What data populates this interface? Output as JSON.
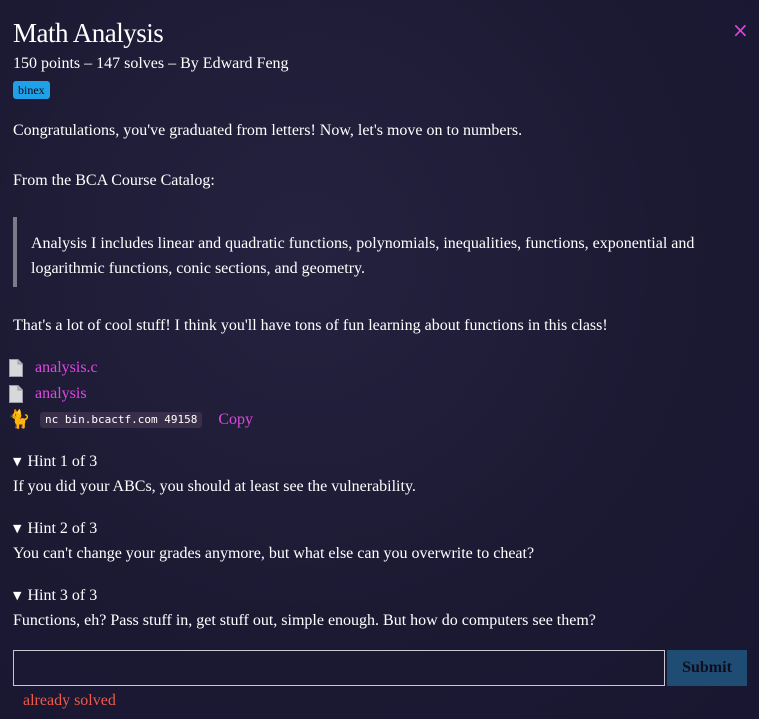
{
  "challenge": {
    "title": "Math Analysis",
    "meta": "150 points – 147 solves – By Edward Feng",
    "tag": "binex",
    "close_icon": "×"
  },
  "description": {
    "intro": "Congratulations, you've graduated from letters! Now, let's move on to numbers.",
    "catalog_lead": "From the BCA Course Catalog:",
    "quote": "Analysis I includes linear and quadratic functions, polynomials, inequalities, functions, exponential and logarithmic functions, conic sections, and geometry.",
    "outro": "That's a lot of cool stuff! I think you'll have tons of fun learning about functions in this class!"
  },
  "files": [
    {
      "name": "analysis.c",
      "icon": "file-icon"
    },
    {
      "name": "analysis",
      "icon": "file-icon"
    }
  ],
  "connection": {
    "icon": "cat-icon",
    "command": "nc bin.bcactf.com 49158",
    "copy_label": "Copy"
  },
  "hints": [
    {
      "label": "Hint 1 of 3",
      "text": "If you did your ABCs, you should at least see the vulnerability."
    },
    {
      "label": "Hint 2 of 3",
      "text": "You can't change your grades anymore, but what else can you overwrite to cheat?"
    },
    {
      "label": "Hint 3 of 3",
      "text": "Functions, eh? Pass stuff in, get stuff out, simple enough. But how do computers see them?"
    }
  ],
  "flag_form": {
    "input_value": "",
    "input_placeholder": "",
    "submit_label": "Submit",
    "status": "already solved"
  },
  "colors": {
    "accent_link": "#e246e2",
    "tag_bg": "#1ea1e8",
    "submit_bg": "#1e4c73",
    "status_error": "#ef5a4a",
    "background": "#1c1a33"
  }
}
